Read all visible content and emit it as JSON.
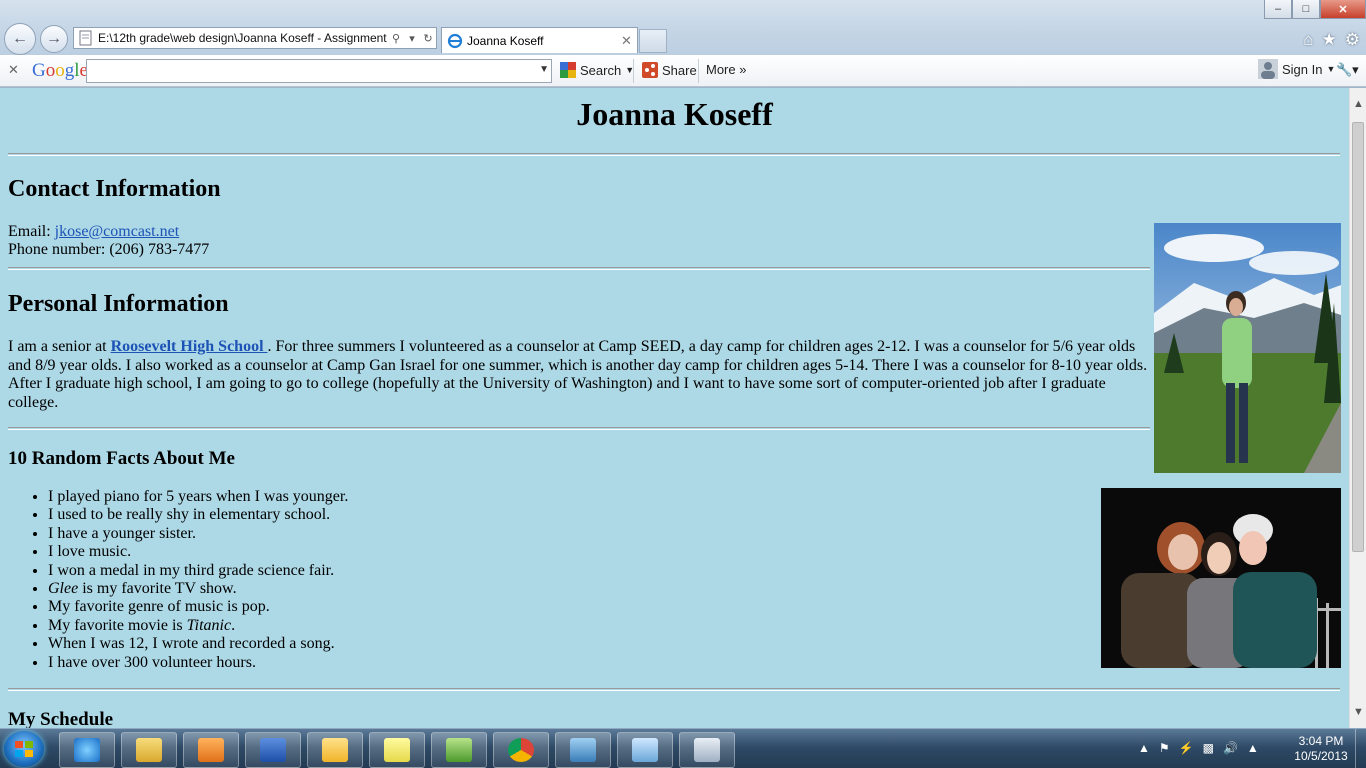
{
  "browser": {
    "address_text": "E:\\12th grade\\web design\\Joanna Koseff - Assignment",
    "tab_title": "Joanna Koseff",
    "window_buttons": {
      "minimize": "–",
      "maximize": "□",
      "close": "✕"
    }
  },
  "google_toolbar": {
    "logo": [
      "G",
      "o",
      "o",
      "g",
      "l",
      "e"
    ],
    "search_label": "Search",
    "share_label": "Share",
    "more_label": "More »",
    "signin_label": "Sign In"
  },
  "page": {
    "title": "Joanna Koseff",
    "contact": {
      "heading": "Contact Information",
      "email_label": "Email:",
      "email": "jkose@comcast.net",
      "phone": "Phone number: (206) 783-7477"
    },
    "personal": {
      "heading": "Personal Information",
      "text_before": "I am a senior at ",
      "school_link": "Roosevelt High School ",
      "text_after": ". For three summers I volunteered as a counselor at Camp SEED, a day camp for children ages 2-12. I was a counselor for 5/6 year olds and 8/9 year olds. I also worked as a counselor at Camp Gan Israel for one summer, which is another day camp for children ages 5-14. There I was a counselor for 8-10 year olds. After I graduate high school, I am going to go to college (hopefully at the University of Washington) and I want to have some sort of computer-oriented job after I graduate college."
    },
    "facts": {
      "heading": "10 Random Facts About Me",
      "items": [
        "I played piano for 5 years when I was younger.",
        "I used to be really shy in elementary school.",
        "I have a younger sister.",
        "I love music.",
        "I won a medal in my third grade science fair.",
        "Glee",
        " is my favorite TV show.",
        "My favorite genre of music is pop.",
        "My favorite movie is ",
        "Titanic",
        ".",
        "When I was 12, I wrote and recorded a song.",
        "I have over 300 volunteer hours."
      ]
    },
    "schedule_heading": "My Schedule"
  },
  "taskbar": {
    "clock_time": "3:04 PM",
    "clock_date": "10/5/2013"
  }
}
